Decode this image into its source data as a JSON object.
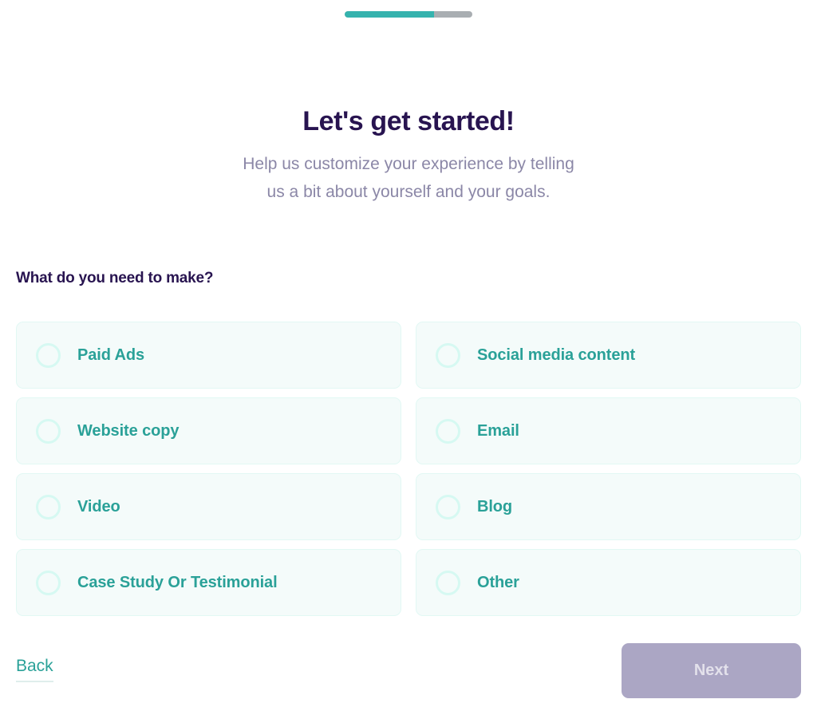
{
  "progress": {
    "percent": 70,
    "fill_color": "#35b3ae",
    "track_color": "#a9aeb2"
  },
  "heading": {
    "title": "Let's get started!",
    "subtitle_line1": "Help us customize your experience by telling",
    "subtitle_line2": "us a bit about yourself and your goals.",
    "title_color": "#281450",
    "subtitle_color": "#8b87a7"
  },
  "question": {
    "label": "What do you need to make?"
  },
  "options": {
    "accent_color": "#2aa198",
    "card_bg": "#f4fbfa",
    "items": [
      {
        "label": "Paid Ads",
        "selected": false
      },
      {
        "label": "Social media content",
        "selected": false
      },
      {
        "label": "Website copy",
        "selected": false
      },
      {
        "label": "Email",
        "selected": false
      },
      {
        "label": "Video",
        "selected": false
      },
      {
        "label": "Blog",
        "selected": false
      },
      {
        "label": "Case Study Or Testimonial",
        "selected": false
      },
      {
        "label": "Other",
        "selected": false
      }
    ]
  },
  "footer": {
    "back_label": "Back",
    "next_label": "Next",
    "next_enabled": false,
    "next_bg": "#aba6c4"
  }
}
